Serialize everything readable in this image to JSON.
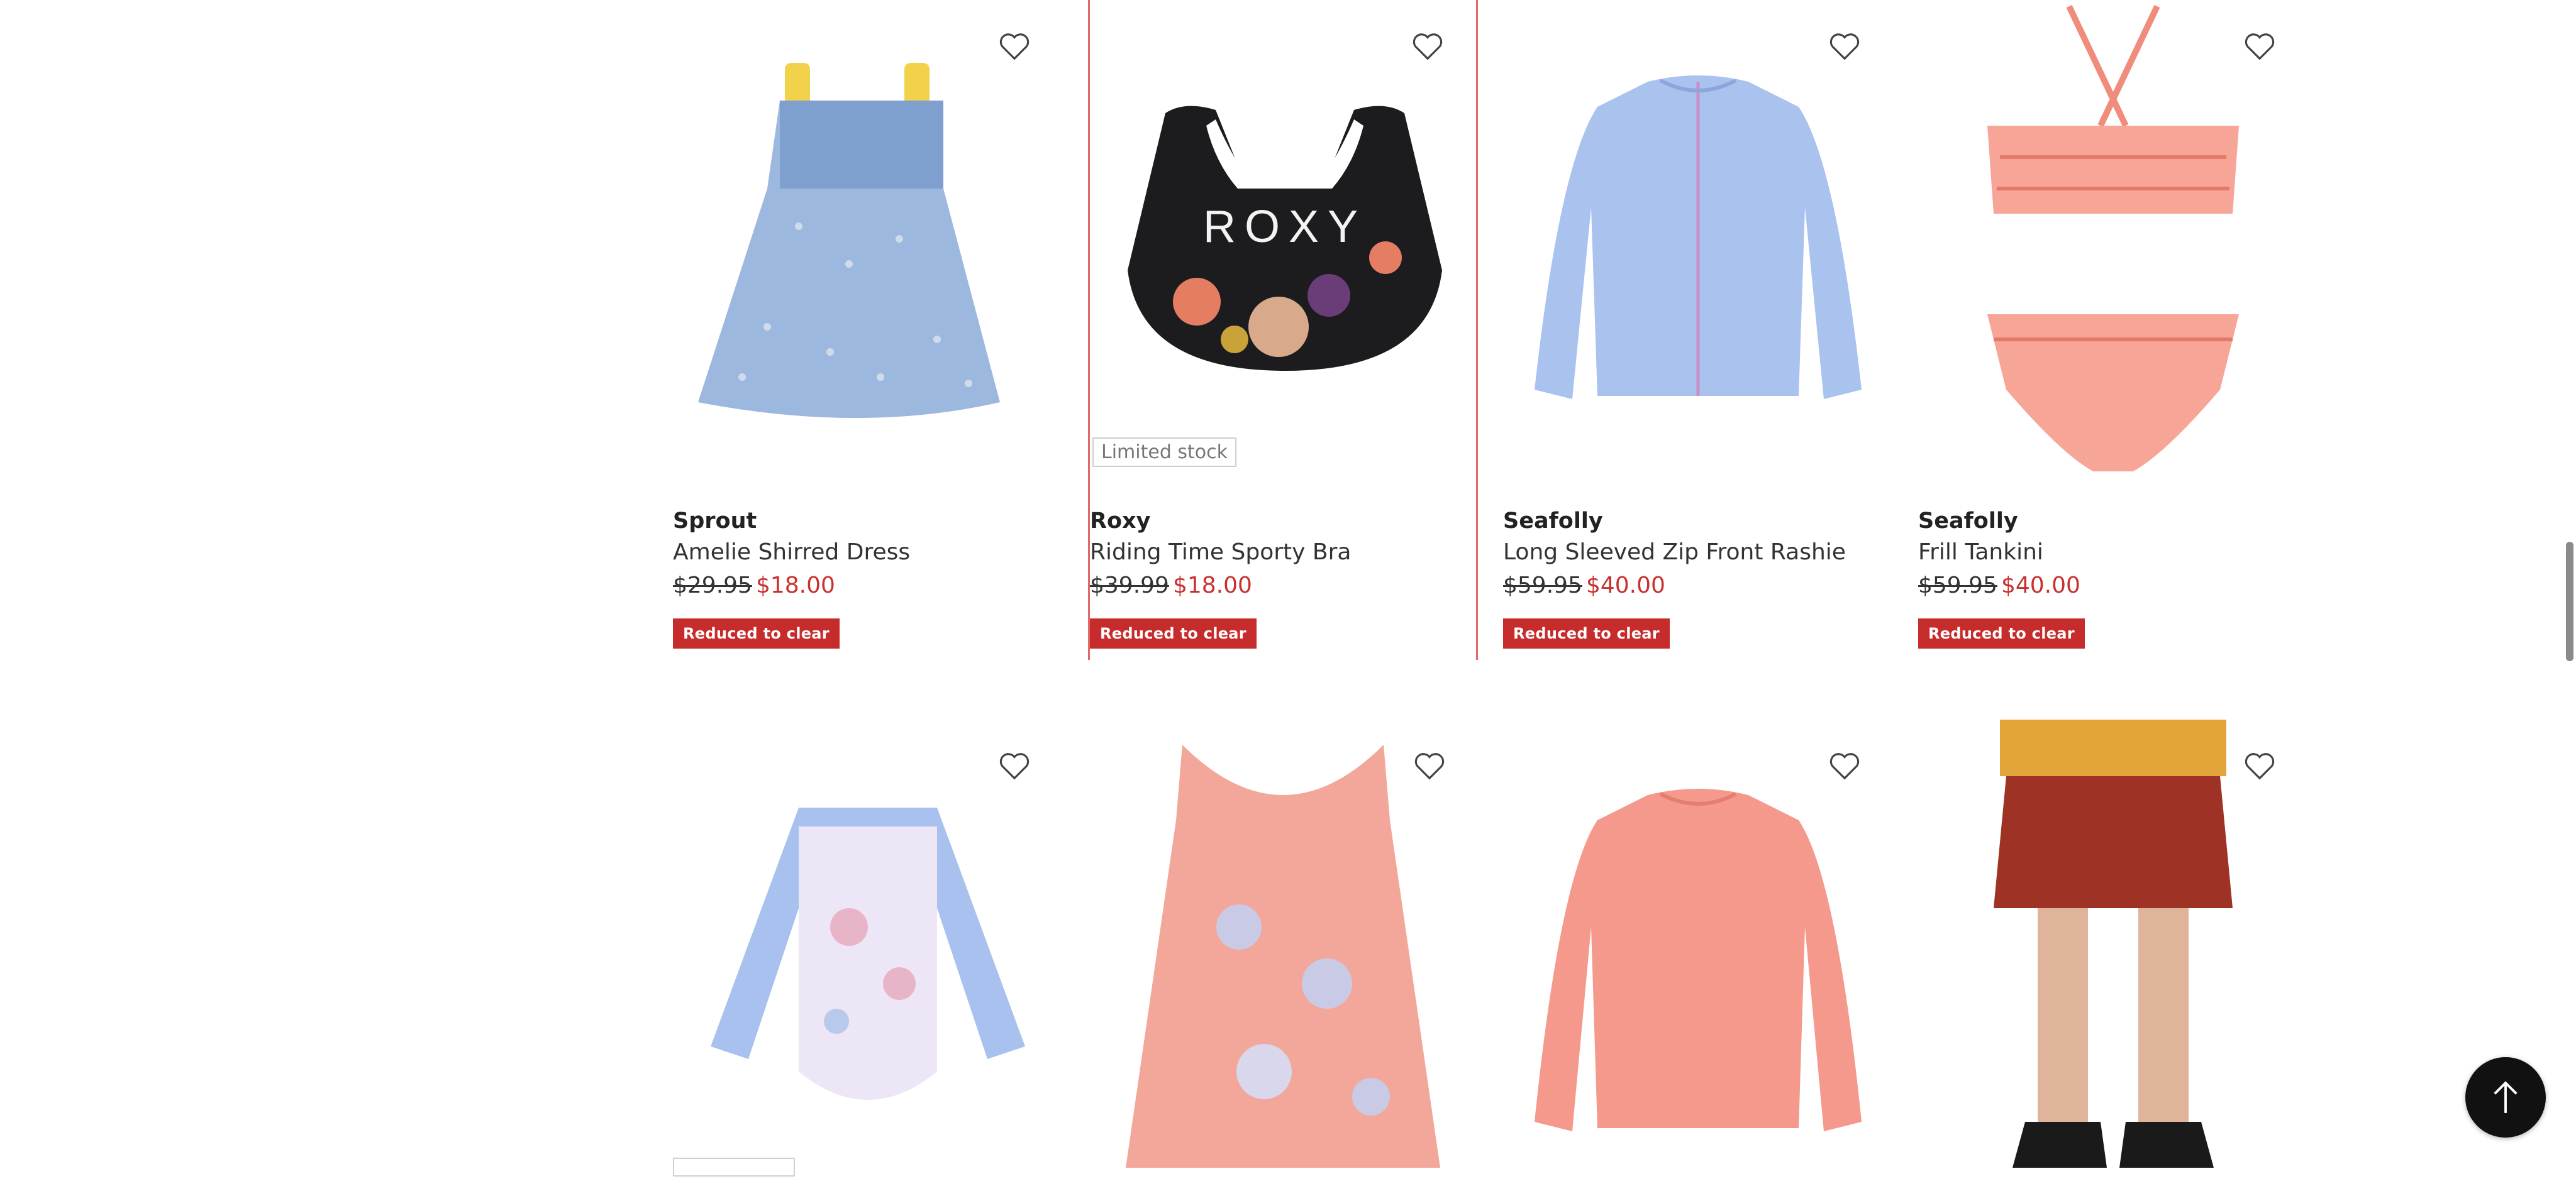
{
  "products": [
    {
      "brand": "Sprout",
      "name": "Amelie Shirred Dress",
      "original_price": "$29.95",
      "sale_price": "$18.00",
      "badge": "Reduced to clear",
      "limited": ""
    },
    {
      "brand": "Roxy",
      "name": "Riding Time Sporty Bra",
      "original_price": "$39.99",
      "sale_price": "$18.00",
      "badge": "Reduced to clear",
      "limited": "Limited stock",
      "print_text": "ROXY"
    },
    {
      "brand": "Seafolly",
      "name": "Long Sleeved Zip Front Rashie",
      "original_price": "$59.95",
      "sale_price": "$40.00",
      "badge": "Reduced to clear",
      "limited": ""
    },
    {
      "brand": "Seafolly",
      "name": "Frill Tankini",
      "original_price": "$59.95",
      "sale_price": "$40.00",
      "badge": "Reduced to clear",
      "limited": ""
    }
  ],
  "colors": {
    "accent_red": "#c72c2c",
    "sale_red": "#c8312f",
    "hover_border": "#e06a6a"
  },
  "icons": {
    "wishlist": "heart-outline-icon",
    "back_to_top": "arrow-up-icon"
  }
}
